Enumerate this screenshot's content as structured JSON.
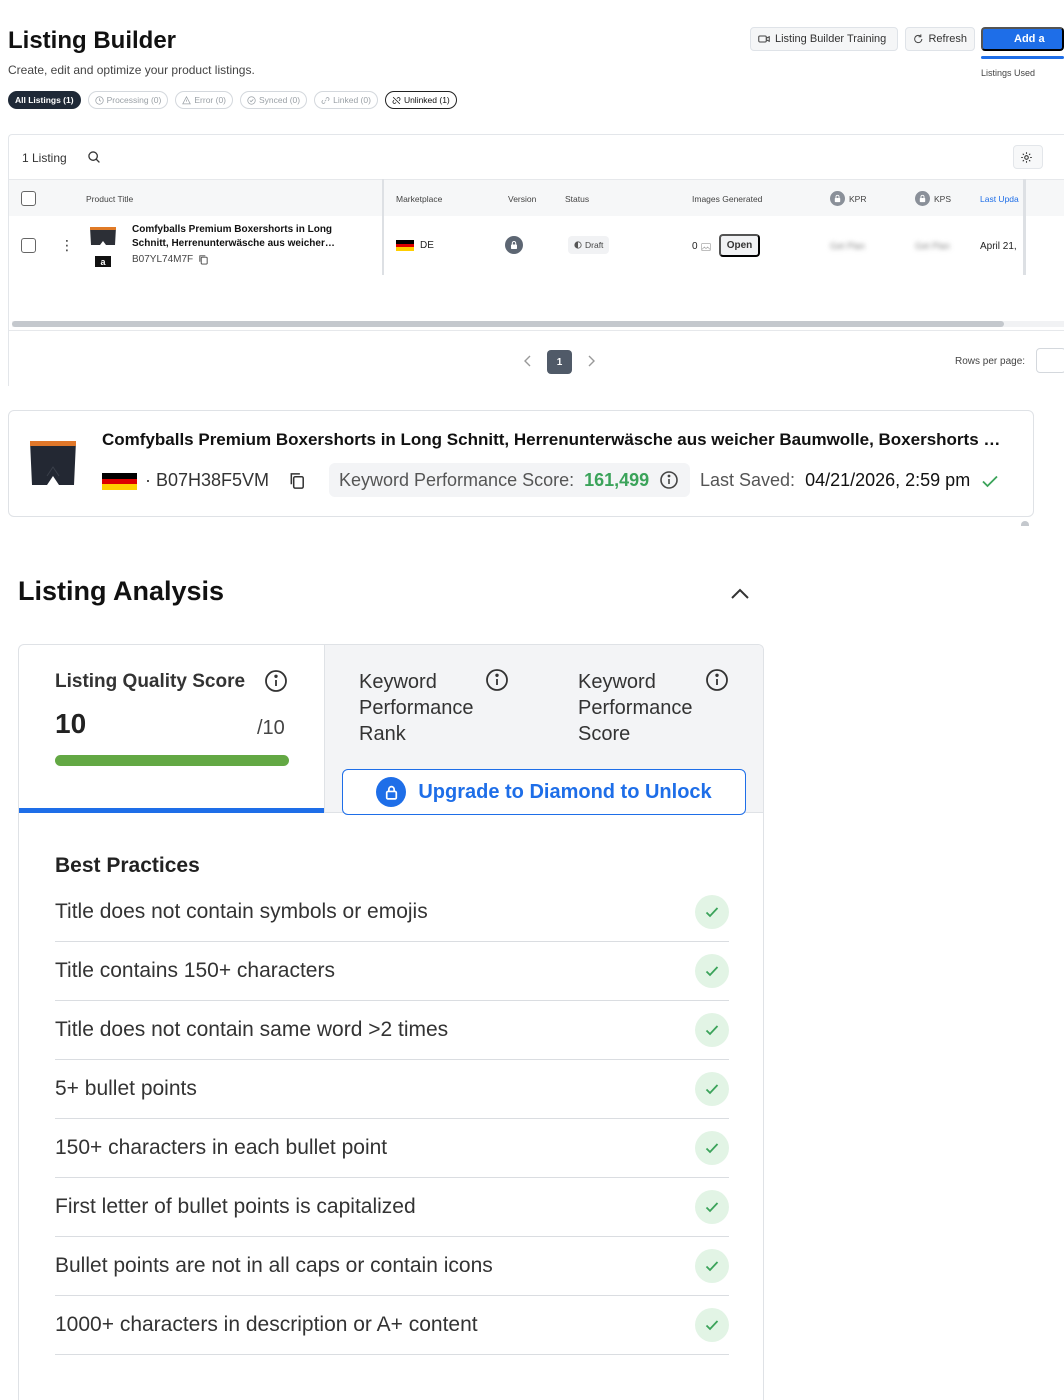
{
  "header": {
    "title": "Listing Builder",
    "subtitle": "Create, edit and optimize your product listings.",
    "training_label": "Listing Builder Training",
    "refresh_label": "Refresh",
    "add_label": "Add a",
    "listings_used_label": "Listings Used"
  },
  "filters": [
    {
      "label": "All Listings (1)",
      "icon": "none",
      "state": "active"
    },
    {
      "label": "Processing (0)",
      "icon": "clock-icon",
      "state": "disabled"
    },
    {
      "label": "Error (0)",
      "icon": "warning-icon",
      "state": "disabled"
    },
    {
      "label": "Synced (0)",
      "icon": "check-circle-icon",
      "state": "disabled"
    },
    {
      "label": "Linked (0)",
      "icon": "link-icon",
      "state": "disabled"
    },
    {
      "label": "Unlinked (1)",
      "icon": "unlink-icon",
      "state": "outlined"
    }
  ],
  "table": {
    "count_label": "1 Listing",
    "columns": {
      "product_title": "Product Title",
      "marketplace": "Marketplace",
      "version": "Version",
      "status": "Status",
      "images_generated": "Images Generated",
      "kpr": "KPR",
      "kps": "KPS",
      "last_updated": "Last Upda"
    },
    "row": {
      "title": "Comfyballs Premium Boxershorts in Long Schnitt, Herrenunterwäsche aus weicher…",
      "asin": "B07YL74M7F",
      "marketplace": "DE",
      "status": "Draft",
      "images_generated": "0",
      "open_label": "Open",
      "kpr_blurred": "Get Plan",
      "kps_blurred": "Get Plan",
      "last_updated": "April 21,"
    },
    "pagination": {
      "current_page": "1",
      "rows_per_page_label": "Rows per page:"
    }
  },
  "product_summary": {
    "title": "Comfyballs Premium Boxershorts in Long Schnitt, Herrenunterwäsche aus weicher Baumwolle, Boxershorts …",
    "asin": "· B07H38F5VM",
    "kps_label": "Keyword Performance Score:",
    "kps_value": "161,499",
    "last_saved_label": "Last Saved:",
    "last_saved_value": "04/21/2026, 2:59 pm"
  },
  "analysis": {
    "title": "Listing Analysis",
    "lqs": {
      "label": "Listing Quality Score",
      "score": "10",
      "max": "/10",
      "fraction": 1.0
    },
    "kpr_label": "Keyword Performance Rank",
    "kps_label": "Keyword Performance Score",
    "upgrade_label": "Upgrade to Diamond to Unlock",
    "best_practices_title": "Best Practices",
    "best_practices": [
      "Title does not contain symbols or emojis",
      "Title contains 150+ characters",
      "Title does not contain same word >2 times",
      "5+ bullet points",
      "150+ characters in each bullet point",
      "First letter of bullet points is capitalized",
      "Bullet points are not in all caps or contain icons",
      "1000+ characters in description or A+ content"
    ]
  },
  "colors": {
    "primary_blue": "#1e6ee8",
    "score_green": "#63a844",
    "kps_green": "#3ba35a",
    "check_green": "#3ba35a",
    "check_bg": "#e2f4e5",
    "flag_de": [
      "#000000",
      "#dd0000",
      "#ffce00"
    ]
  }
}
